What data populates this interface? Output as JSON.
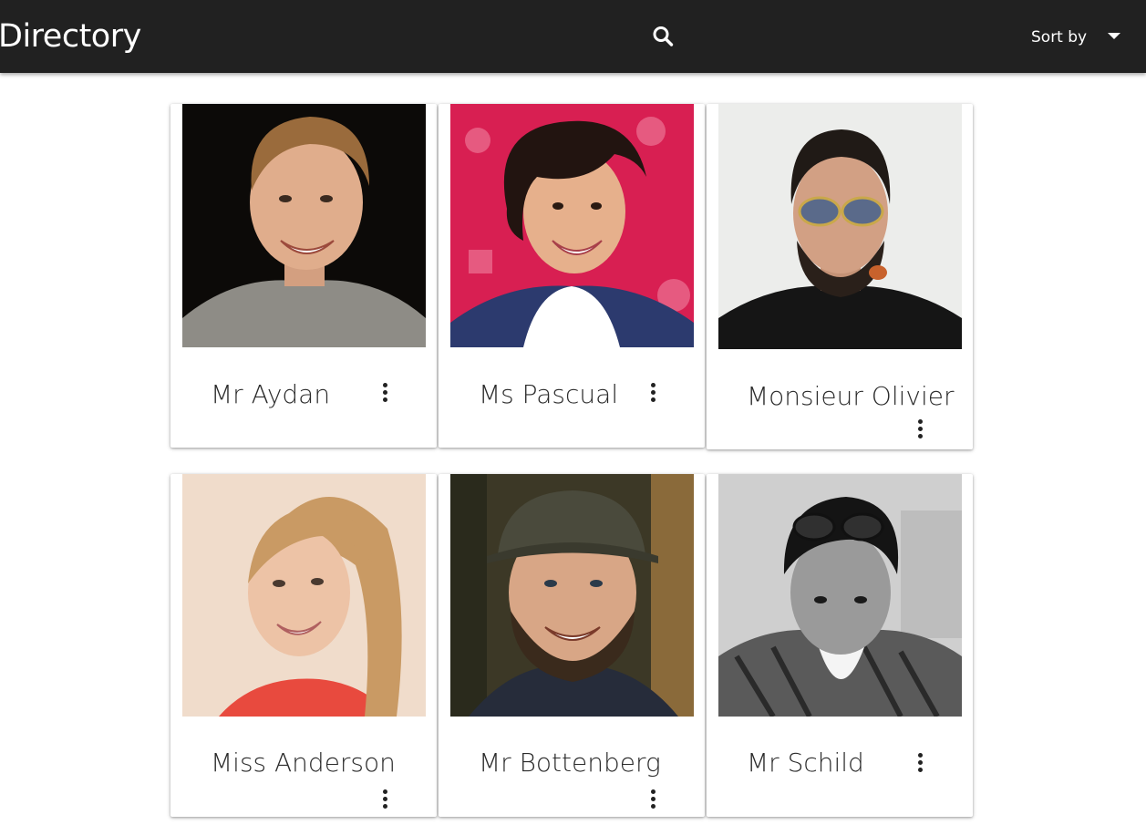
{
  "app": {
    "title": "Directory",
    "search_icon": "search-icon",
    "sort_label": "Sort by",
    "sort_icon": "caret-down-icon",
    "bar_color": "#212121"
  },
  "people": [
    {
      "name": "Mr Aydan",
      "menu_icon": "more-vert-icon"
    },
    {
      "name": "Ms Pascual",
      "menu_icon": "more-vert-icon"
    },
    {
      "name": "Monsieur Olivier",
      "menu_icon": "more-vert-icon"
    },
    {
      "name": "Miss Anderson",
      "menu_icon": "more-vert-icon"
    },
    {
      "name": "Mr Bottenberg",
      "menu_icon": "more-vert-icon"
    },
    {
      "name": "Mr Schild",
      "menu_icon": "more-vert-icon"
    }
  ]
}
